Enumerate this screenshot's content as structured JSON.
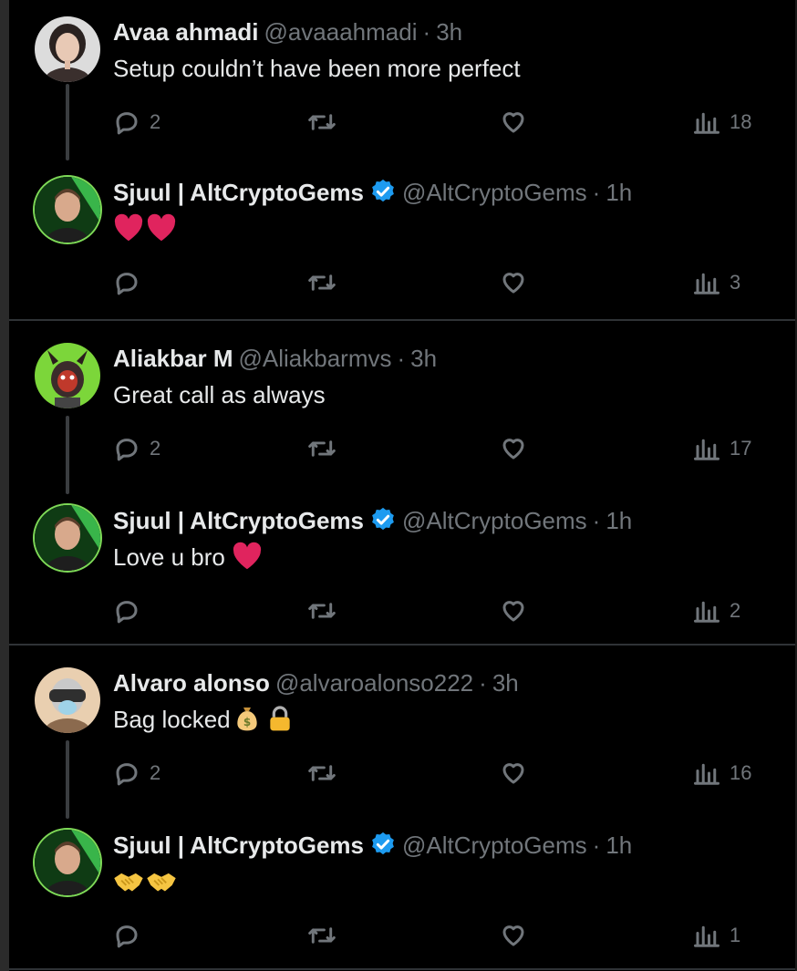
{
  "threads": [
    {
      "reply": {
        "name": "Avaa ahmadi",
        "handle": "@avaaahmadi",
        "separator": "·",
        "time": "3h",
        "text": "Setup couldn’t have been more perfect",
        "reply_count": "2",
        "view_count": "18",
        "avatar": "woman-portrait"
      },
      "response": {
        "name": "Sjuul | AltCryptoGems",
        "handle": "@AltCryptoGems",
        "separator": "·",
        "time": "1h",
        "text": "",
        "emoji": [
          "heart-emoji",
          "heart-emoji"
        ],
        "reply_count": "",
        "view_count": "3",
        "avatar": "man-portrait-green"
      }
    },
    {
      "reply": {
        "name": "Aliakbar M",
        "handle": "@Aliakbarmvs",
        "separator": "·",
        "time": "3h",
        "text": "Great call as always",
        "reply_count": "2",
        "view_count": "17",
        "avatar": "ape-nft"
      },
      "response": {
        "name": "Sjuul | AltCryptoGems",
        "handle": "@AltCryptoGems",
        "separator": "·",
        "time": "1h",
        "text": "Love u bro",
        "emoji": [
          "heart-emoji"
        ],
        "reply_count": "",
        "view_count": "2",
        "avatar": "man-portrait-green"
      }
    },
    {
      "reply": {
        "name": "Alvaro alonso",
        "handle": "@alvaroalonso222",
        "separator": "·",
        "time": "3h",
        "text": "Bag locked",
        "emoji": [
          "money-bag-emoji",
          "lock-emoji"
        ],
        "reply_count": "2",
        "view_count": "16",
        "avatar": "vr-headset-character"
      },
      "response": {
        "name": "Sjuul | AltCryptoGems",
        "handle": "@AltCryptoGems",
        "separator": "·",
        "time": "1h",
        "text": "",
        "emoji": [
          "handshake-emoji",
          "handshake-emoji"
        ],
        "reply_count": "",
        "view_count": "1",
        "avatar": "man-portrait-green"
      }
    }
  ],
  "colors": {
    "background": "#000000",
    "primary_text": "#e7e9ea",
    "secondary_text": "#71767b",
    "divider": "#2f3336",
    "verified": "#1d9bf0",
    "heart": "#e0245e"
  }
}
